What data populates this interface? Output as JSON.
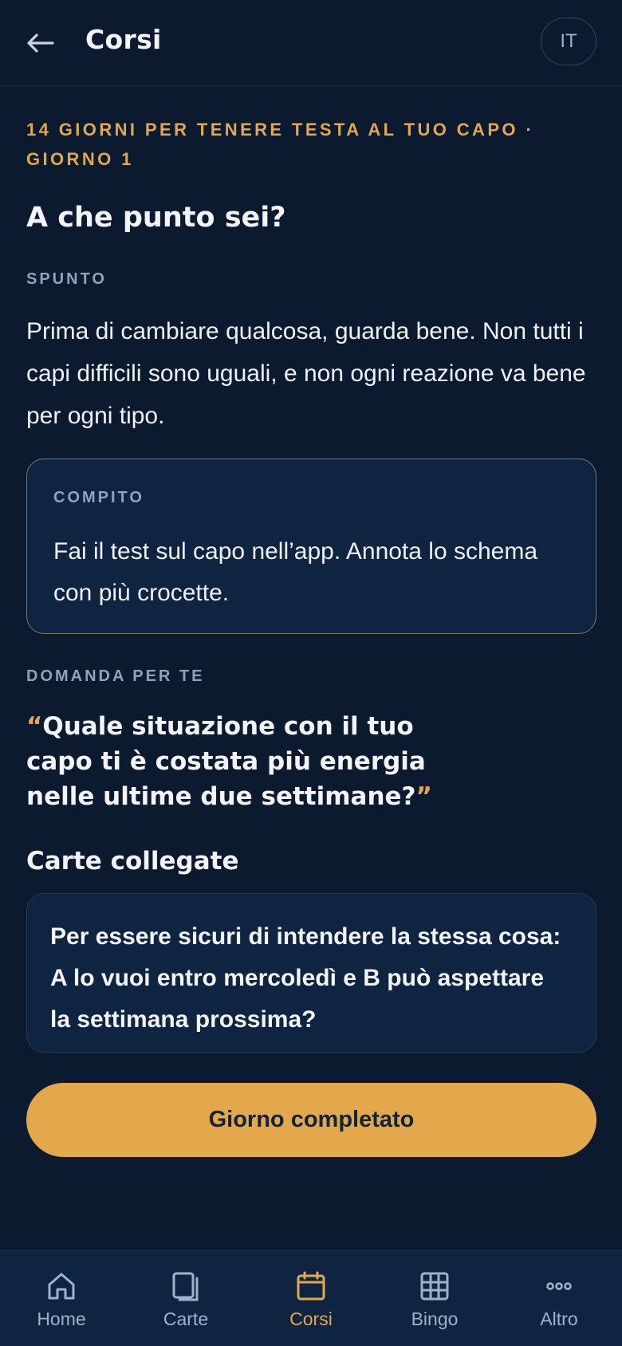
{
  "header": {
    "title": "Corsi",
    "lang": "IT"
  },
  "course": {
    "label": "14 GIORNI PER TENERE TESTA AL TUO CAPO · GIORNO 1",
    "day_title": "A che punto sei?"
  },
  "prompt": {
    "label": "SPUNTO",
    "text": "Prima di cambiare qualcosa, guarda bene. Non tutti i capi difficili sono uguali, e non ogni reazione va bene per ogni tipo."
  },
  "task": {
    "label": "COMPITO",
    "text": "Fai il test sul capo nell’app. Annota lo schema con più crocette."
  },
  "question": {
    "label": "DOMANDA PER TE",
    "open_quote": "“",
    "text": "Quale situazione con il tuo capo ti è costata più energia nelle ultime due settimane?",
    "close_quote": "”"
  },
  "linked": {
    "title": "Carte collegate",
    "card_text": "Per essere sicuri di intendere la stessa cosa: A lo vuoi entro mercoledì e B può aspettare la settimana prossima?"
  },
  "complete_button": "Giorno completato",
  "nav": {
    "items": [
      {
        "label": "Home",
        "icon": "home-icon"
      },
      {
        "label": "Carte",
        "icon": "cards-icon"
      },
      {
        "label": "Corsi",
        "icon": "calendar-icon"
      },
      {
        "label": "Bingo",
        "icon": "grid-icon"
      },
      {
        "label": "Altro",
        "icon": "more-icon"
      }
    ],
    "active": "Corsi"
  },
  "colors": {
    "background": "#0b1a2e",
    "card": "#0f2440",
    "accent": "#e3a84b",
    "muted": "#8ea3bd"
  }
}
